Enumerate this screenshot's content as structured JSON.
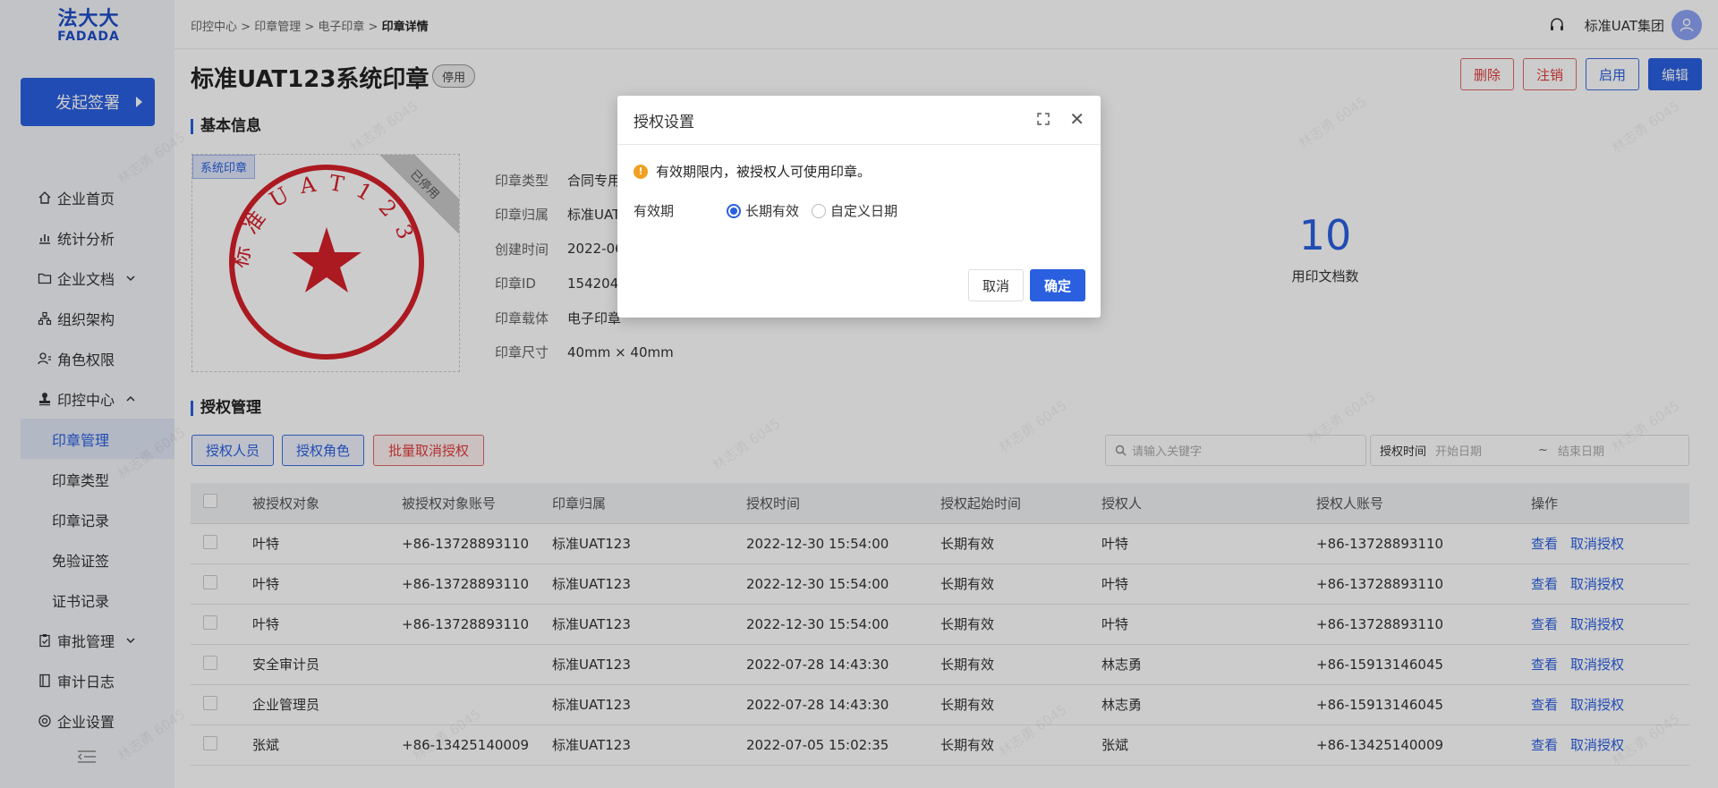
{
  "logo": {
    "line1": "法大大",
    "line2": "FADADA"
  },
  "sidebar": {
    "launch_label": "发起签署",
    "items": [
      {
        "label": "企业首页",
        "icon": "home-icon"
      },
      {
        "label": "统计分析",
        "icon": "chart-icon"
      },
      {
        "label": "企业文档",
        "icon": "folder-icon"
      },
      {
        "label": "组织架构",
        "icon": "org-icon"
      },
      {
        "label": "角色权限",
        "icon": "user-role-icon"
      },
      {
        "label": "印控中心",
        "icon": "stamp-icon"
      }
    ],
    "sub_items": [
      "印章管理",
      "印章类型",
      "印章记录",
      "免验证签",
      "证书记录"
    ],
    "items_after": [
      {
        "label": "审批管理",
        "icon": "clipboard-icon"
      },
      {
        "label": "审计日志",
        "icon": "log-icon"
      },
      {
        "label": "企业设置",
        "icon": "settings-icon"
      }
    ]
  },
  "header": {
    "breadcrumb": [
      "印控中心",
      "印章管理",
      "电子印章",
      "印章详情"
    ],
    "company": "标准UAT集团"
  },
  "page": {
    "title": "标准UAT123系统印章",
    "status": "停用",
    "actions": {
      "delete": "删除",
      "revoke": "注销",
      "enable": "启用",
      "edit": "编辑"
    }
  },
  "basic": {
    "section_title": "基本信息",
    "seal_tag": "系统印章",
    "ribbon": "已停用",
    "seal_text": "标准UAT123",
    "fields": [
      {
        "k": "印章类型",
        "v": "合同专用"
      },
      {
        "k": "印章归属",
        "v": "标准UAT"
      },
      {
        "k": "创建时间",
        "v": "2022-06"
      },
      {
        "k": "印章ID",
        "v": "1542046"
      },
      {
        "k": "印章载体",
        "v": "电子印章"
      },
      {
        "k": "印章尺寸",
        "v": "40mm × 40mm"
      }
    ],
    "stat_value": "10",
    "stat_label": "用印文档数"
  },
  "auth": {
    "section_title": "授权管理",
    "tabs": {
      "person": "授权人员",
      "role": "授权角色",
      "batch_cancel": "批量取消授权"
    },
    "search_placeholder": "请输入关键字",
    "date_label": "授权时间",
    "date_start": "开始日期",
    "date_sep": "~",
    "date_end": "结束日期",
    "columns": [
      "被授权对象",
      "被授权对象账号",
      "印章归属",
      "授权时间",
      "授权起始时间",
      "授权人",
      "授权人账号",
      "操作"
    ],
    "rows": [
      [
        "叶特",
        "+86-13728893110",
        "标准UAT123",
        "2022-12-30 15:54:00",
        "长期有效",
        "叶特",
        "+86-13728893110"
      ],
      [
        "叶特",
        "+86-13728893110",
        "标准UAT123",
        "2022-12-30 15:54:00",
        "长期有效",
        "叶特",
        "+86-13728893110"
      ],
      [
        "叶特",
        "+86-13728893110",
        "标准UAT123",
        "2022-12-30 15:54:00",
        "长期有效",
        "叶特",
        "+86-13728893110"
      ],
      [
        "安全审计员",
        "",
        "标准UAT123",
        "2022-07-28 14:43:30",
        "长期有效",
        "林志勇",
        "+86-15913146045"
      ],
      [
        "企业管理员",
        "",
        "标准UAT123",
        "2022-07-28 14:43:30",
        "长期有效",
        "林志勇",
        "+86-15913146045"
      ],
      [
        "张斌",
        "+86-13425140009",
        "标准UAT123",
        "2022-07-05 15:02:35",
        "长期有效",
        "张斌",
        "+86-13425140009"
      ]
    ],
    "view_label": "查看",
    "cancel_label": "取消授权"
  },
  "modal": {
    "title": "授权设置",
    "notice": "有效期限内，被授权人可使用印章。",
    "period_label": "有效期",
    "option_long": "长期有效",
    "option_custom": "自定义日期",
    "cancel": "取消",
    "ok": "确定"
  },
  "watermark": "林志勇 6045",
  "colors": {
    "primary": "#2a5fe0",
    "danger": "#e03c3c",
    "seal": "#d6202a",
    "warning": "#f0a020"
  }
}
